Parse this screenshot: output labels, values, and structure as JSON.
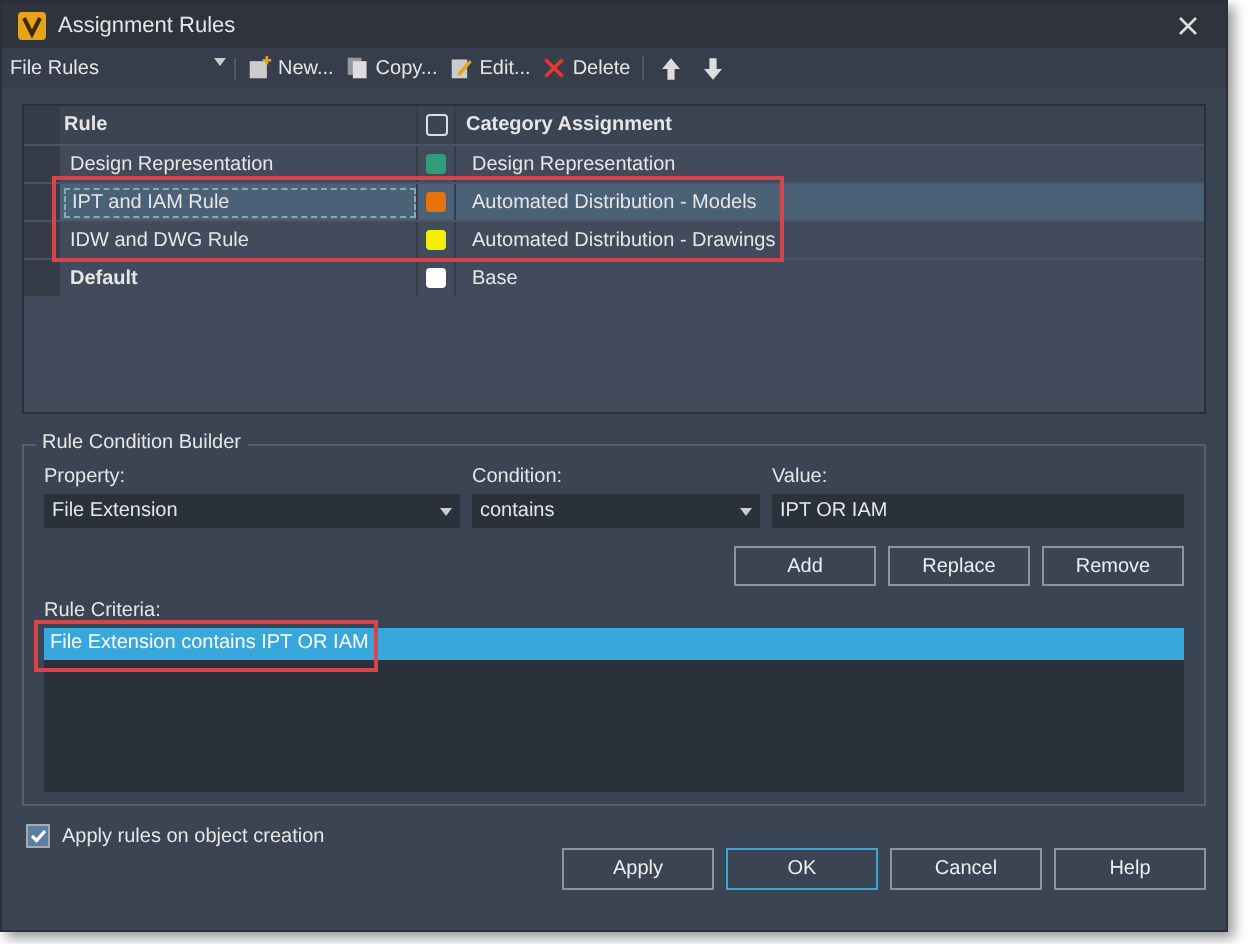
{
  "window": {
    "title": "Assignment Rules"
  },
  "toolbar": {
    "rule_type": "File Rules",
    "buttons": [
      {
        "kind": "new",
        "label": "New..."
      },
      {
        "kind": "copy",
        "label": "Copy..."
      },
      {
        "kind": "edit",
        "label": "Edit..."
      },
      {
        "kind": "delete",
        "label": "Delete"
      },
      {
        "kind": "up"
      },
      {
        "kind": "down"
      }
    ]
  },
  "rules_table": {
    "columns": [
      "Rule",
      "Category Assignment"
    ],
    "header_checked": false,
    "rows": [
      {
        "rule": "Design Representation",
        "category": "Design Representation",
        "color": "#2e9e7a",
        "selected": false,
        "bold": false,
        "annotated": false
      },
      {
        "rule": "IPT and IAM Rule",
        "category": "Automated Distribution - Models",
        "color": "#e8720c",
        "selected": true,
        "bold": false,
        "annotated": true
      },
      {
        "rule": "IDW and DWG Rule",
        "category": "Automated Distribution - Drawings",
        "color": "#f5f000",
        "selected": false,
        "bold": false,
        "annotated": true
      },
      {
        "rule": "Default",
        "category": "Base",
        "color": "#ffffff",
        "selected": false,
        "bold": true,
        "annotated": false
      }
    ]
  },
  "condition_builder": {
    "title": "Rule Condition Builder",
    "property": {
      "label": "Property:",
      "value": "File Extension"
    },
    "condition": {
      "label": "Condition:",
      "value": "contains"
    },
    "value": {
      "label": "Value:",
      "value": "IPT OR IAM"
    },
    "buttons": [
      "Add",
      "Replace",
      "Remove"
    ],
    "criteria_label": "Rule Criteria:",
    "criteria": [
      {
        "text": "File Extension contains IPT OR IAM",
        "selected": true,
        "annotated": true
      }
    ]
  },
  "apply_on_creation": {
    "label": "Apply rules on object creation",
    "checked": true
  },
  "buttons": [
    {
      "label": "Apply",
      "default": false
    },
    {
      "label": "OK",
      "default": true
    },
    {
      "label": "Cancel",
      "default": false
    },
    {
      "label": "Help",
      "default": false
    }
  ]
}
